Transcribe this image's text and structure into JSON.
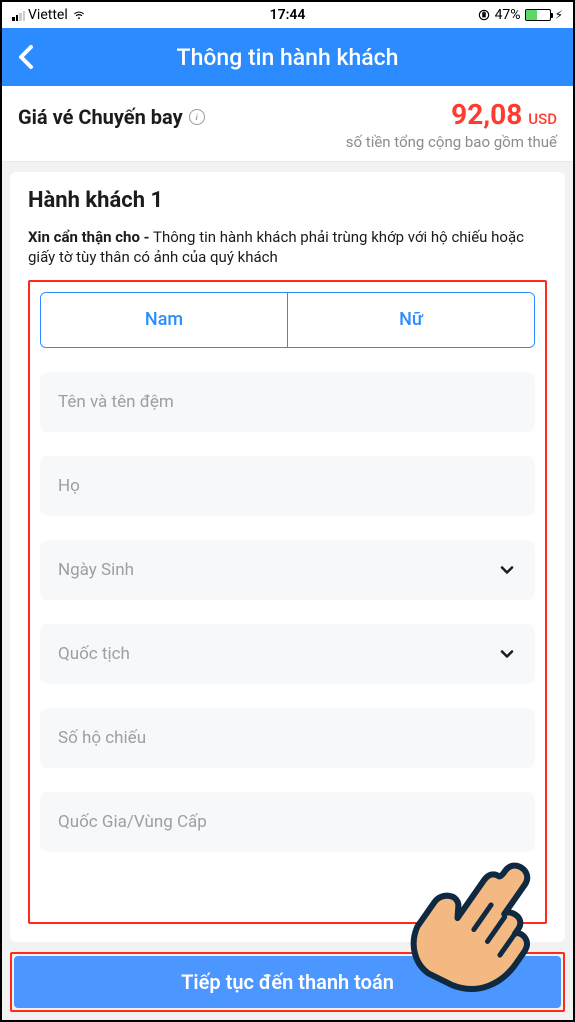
{
  "status": {
    "carrier": "Viettel",
    "time": "17:44",
    "battery_pct": "47%"
  },
  "nav": {
    "title": "Thông tin hành khách"
  },
  "price": {
    "label": "Giá vé Chuyến bay",
    "amount": "92,08",
    "currency": "USD",
    "sub": "số tiền tổng cộng bao gồm thuế"
  },
  "passenger": {
    "title": "Hành khách 1",
    "notice_bold": "Xin cẩn thận cho -",
    "notice_rest": " Thông tin hành khách phải trùng khớp với hộ chiếu hoặc giấy tờ tùy thân có ảnh của quý khách",
    "gender": {
      "male": "Nam",
      "female": "Nữ"
    },
    "fields": {
      "given_name": "Tên và tên đệm",
      "surname": "Họ",
      "dob": "Ngày Sinh",
      "nationality": "Quốc tịch",
      "passport_no": "Số hộ chiếu",
      "issuing_country": "Quốc Gia/Vùng Cấp"
    }
  },
  "footer": {
    "continue": "Tiếp tục đến thanh toán"
  }
}
